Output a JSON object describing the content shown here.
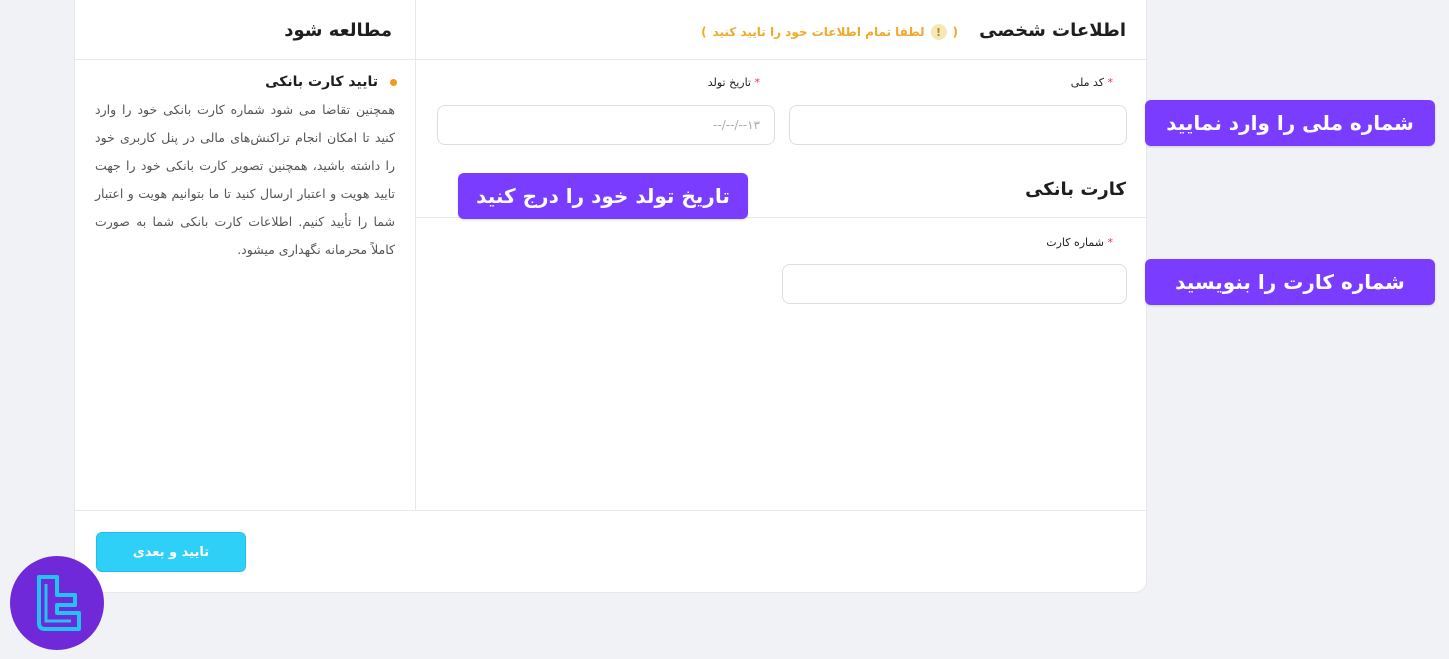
{
  "study_panel": {
    "title": "مطالعه شود",
    "heading": "تایید کارت بانکی",
    "text": "همچنین تقاضا می شود شماره کارت بانکی خود را وارد کنید تا امکان انجام تراکنش‌های مالی در پنل کاربری خود را داشته باشید، همچنین تصویر کارت بانکی خود را جهت تایید هویت و اعتبار ارسال کنید تا ما بتوانیم هویت و اعتبار شما را تأیید کنیم. اطلاعات کارت بانکی شما به صورت کاملاً محرمانه نگهداری میشود."
  },
  "personal_info": {
    "title": "اطلاعات شخصی",
    "warning_open": "(",
    "warning_icon": "!",
    "warning_text": "لطفا تمام اطلاعات خود را تایید کنید",
    "warning_close": ")",
    "national_code": {
      "label": "کد ملی",
      "required": "*",
      "value": "",
      "placeholder": ""
    },
    "birth_date": {
      "label": "تاریخ تولد",
      "required": "*",
      "value": "",
      "placeholder": "۱۳--/--/--"
    }
  },
  "bank_card": {
    "title": "کارت بانکی",
    "card_number": {
      "label": "شماره کارت",
      "required": "*",
      "value": "",
      "placeholder": ""
    }
  },
  "footer": {
    "submit_label": "تایید و بعدی"
  },
  "callouts": {
    "national_code": "شماره ملی را وارد نمایید",
    "birth_date": "تاریخ تولد خود را درج کنید",
    "card_number": "شماره کارت را بنویسید"
  },
  "colors": {
    "accent": "#2fd0f7",
    "callout": "#7a3cff",
    "warning": "#f0a92a",
    "required": "#e0393e",
    "logo_bg": "#6f29d9",
    "logo_mark": "#22c3f0"
  }
}
